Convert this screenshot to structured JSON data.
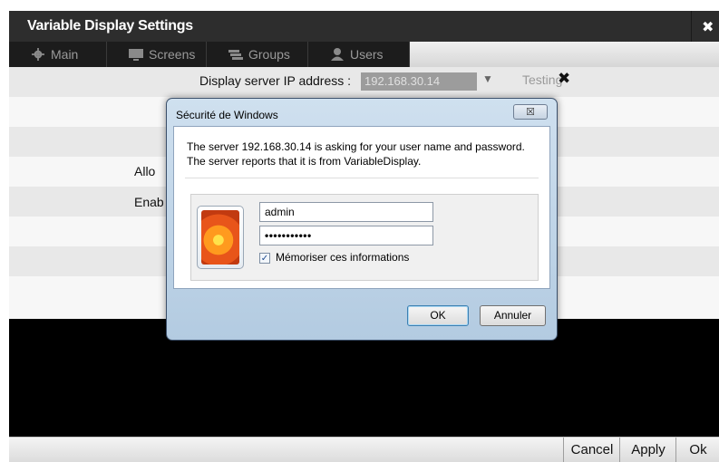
{
  "app": {
    "title": "Variable Display Settings",
    "close_icon": "close-x-icon",
    "tabs": [
      {
        "label": "Main",
        "icon": "gear-icon"
      },
      {
        "label": "Screens",
        "icon": "monitor-icon"
      },
      {
        "label": "Groups",
        "icon": "stack-icon"
      },
      {
        "label": "Users",
        "icon": "user-icon"
      }
    ],
    "fields": {
      "server_ip_label": "Display server IP address :",
      "server_ip_value": "192.168.30.14",
      "testing_label": "Testing",
      "allow_label": "Allo",
      "enable_label": "Enab"
    },
    "footer": {
      "cancel": "Cancel",
      "apply": "Apply",
      "ok": "Ok"
    }
  },
  "dialog": {
    "title": "Sécurité de Windows",
    "message": "The server 192.168.30.14 is asking for your user name and password. The server reports that it is from VariableDisplay.",
    "username": "admin",
    "password_mask": "•••••••••••",
    "remember_label": "Mémoriser ces informations",
    "remember_checked": true,
    "ok_label": "OK",
    "cancel_label": "Annuler",
    "close_label": "☒"
  }
}
